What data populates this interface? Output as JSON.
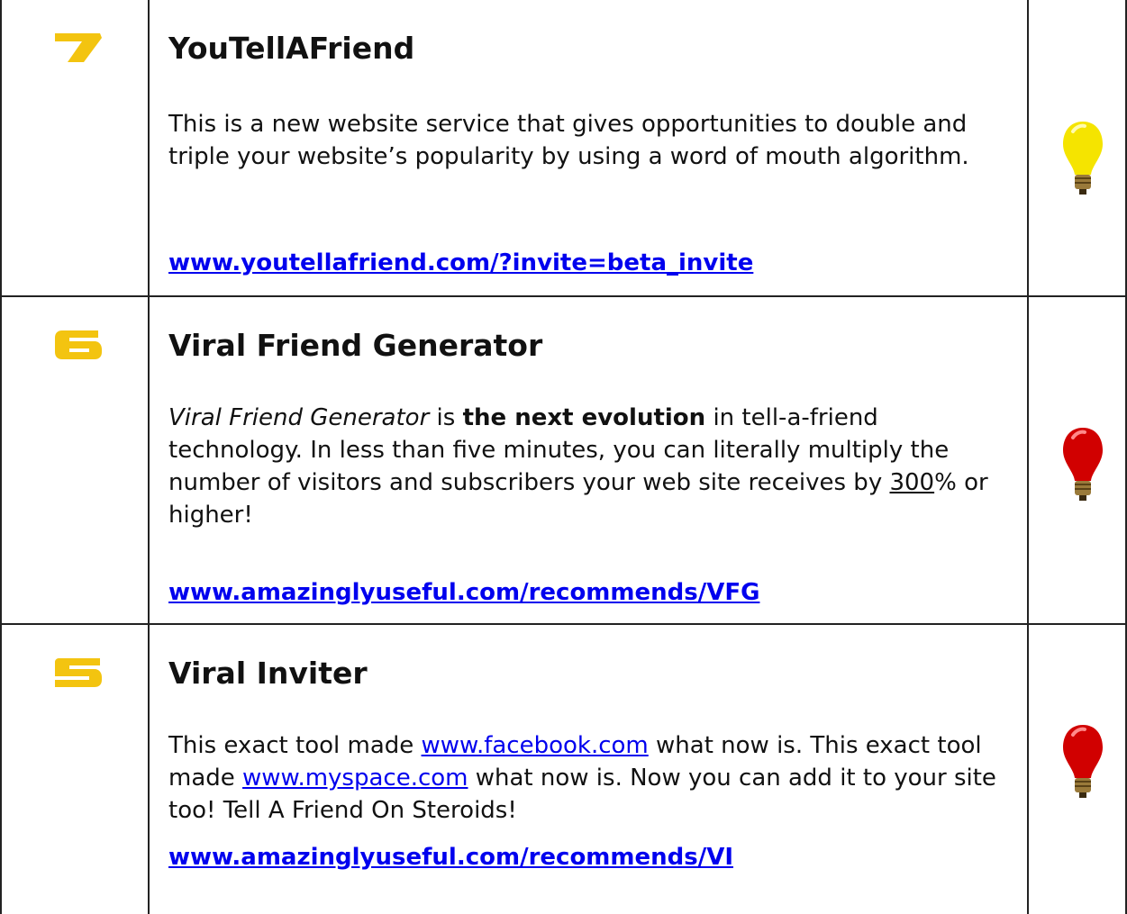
{
  "icons": {
    "rank_color": "#f3c410",
    "bulb_yellow": "#f5e400",
    "bulb_red": "#d10000",
    "bulb_base": "#9a7a3a",
    "link_color": "#0000ee"
  },
  "items": [
    {
      "rank": "7",
      "rank_icon": "number-seven-icon",
      "title": "YouTellAFriend",
      "desc": "This is a new website service that gives opportunities to double and triple your website’s popularity by using a word of mouth algorithm.",
      "link": "www.youtellafriend.com/?invite=beta_invite",
      "bulb": "yellow-lightbulb-icon"
    },
    {
      "rank": "6",
      "rank_icon": "number-six-icon",
      "title": "Viral Friend Generator",
      "desc_parts": {
        "p1": "Viral Friend Generator",
        "p2": " is ",
        "p3": "the next evolution",
        "p4": " in tell-a-friend technology. In less than five minutes, you can literally multiply the number of visitors and subscribers your web site receives by ",
        "p5": "300",
        "p6": "% or higher!"
      },
      "link": "www.amazinglyuseful.com/recommends/VFG",
      "bulb": "red-lightbulb-icon"
    },
    {
      "rank": "5",
      "rank_icon": "number-five-icon",
      "title": "Viral Inviter",
      "desc_parts": {
        "p1": "This exact tool made ",
        "link1": "www.facebook.com",
        "p2": " what now is. This exact tool made ",
        "link2": "www.myspace.com",
        "p3": " what now is. Now you can add it to your site too! Tell A Friend On Steroids!"
      },
      "link": "www.amazinglyuseful.com/recommends/VI",
      "bulb": "red-lightbulb-icon"
    }
  ]
}
